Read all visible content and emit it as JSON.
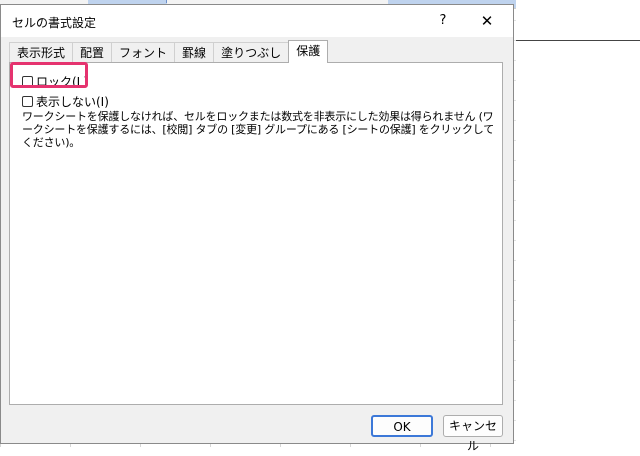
{
  "dialog": {
    "title": "セルの書式設定",
    "help_glyph": "?",
    "close_glyph": "✕"
  },
  "tabs": [
    {
      "label": "表示形式"
    },
    {
      "label": "配置"
    },
    {
      "label": "フォント"
    },
    {
      "label": "罫線"
    },
    {
      "label": "塗りつぶし"
    },
    {
      "label": "保護",
      "active": true
    }
  ],
  "protection": {
    "lock_label": "ロック(L)",
    "lock_checked": false,
    "hidden_label": "表示しない(I)",
    "hidden_checked": false,
    "description": "ワークシートを保護しなければ、セルをロックまたは数式を非表示にした効果は得られません (ワークシートを保護するには、[校閲] タブの [変更] グループにある [シートの保護] をクリックしてください)。"
  },
  "buttons": {
    "ok": "OK",
    "cancel": "キャンセル"
  },
  "colors": {
    "highlight": "#e5336f",
    "ok_border": "#3c78d8"
  }
}
